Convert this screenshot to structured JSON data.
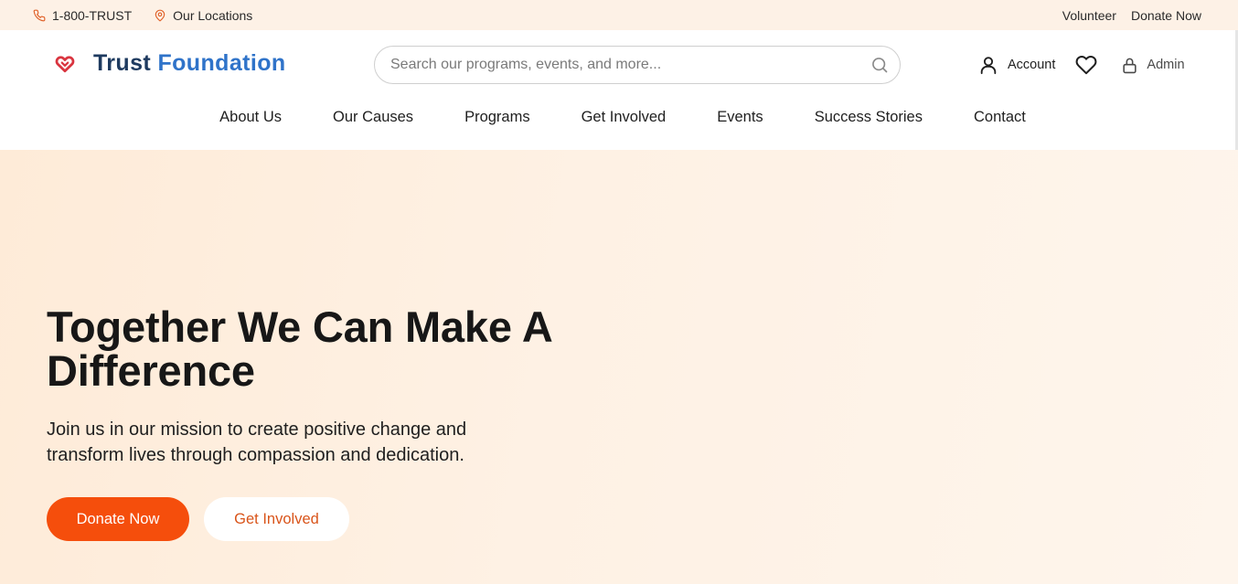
{
  "topbar": {
    "phone": "1-800-TRUST",
    "locations": "Our Locations",
    "volunteer": "Volunteer",
    "donate": "Donate Now"
  },
  "header": {
    "logo_part1": "Trust ",
    "logo_part2": "Foundation",
    "logo_icon": "heart-icon",
    "search_placeholder": "Search our programs, events, and more...",
    "account": "Account",
    "admin": "Admin"
  },
  "nav": {
    "items": [
      "About Us",
      "Our Causes",
      "Programs",
      "Get Involved",
      "Events",
      "Success Stories",
      "Contact"
    ]
  },
  "hero": {
    "title": "Together We Can Make A Difference",
    "subtitle": "Join us in our mission to create positive change and transform lives through compassion and dedication.",
    "primary_button": "Donate Now",
    "secondary_button": "Get Involved"
  },
  "colors": {
    "accent": "#f54e0c",
    "logo_dark": "#1e3a5f",
    "logo_blue": "#2f73c9",
    "topbar_bg": "#fdf1e6",
    "hero_bg": "#feebd8"
  },
  "icons": [
    "phone-icon",
    "map-pin-icon",
    "heart-icon",
    "search-icon",
    "user-icon",
    "heart-outline-icon",
    "lock-icon"
  ]
}
